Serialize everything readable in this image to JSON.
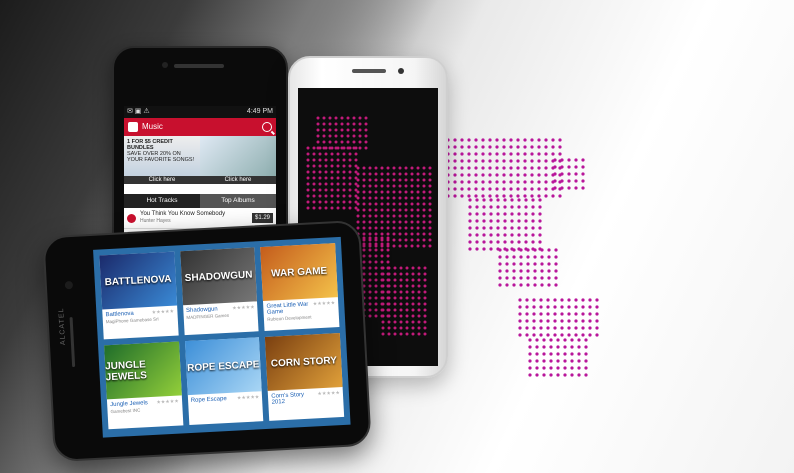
{
  "phone_music": {
    "status_time": "4:49 PM",
    "app_title": "Music",
    "promo_left": "1 FOR $5 CREDIT BUNDLES",
    "promo_left_sub": "SAVE OVER 20% ON YOUR FAVORITE SONGS!",
    "promo_click_left": "Click here",
    "promo_click_right": "Click here",
    "tab_hot": "Hot Tracks",
    "tab_albums": "Top Albums",
    "track_title": "You Think You Know Somebody",
    "track_artist": "Hunter Hayes",
    "track_price": "$1.29"
  },
  "phone_games": {
    "brand": "ALCATEL",
    "games": [
      {
        "art": "BATTLENOVA",
        "name": "Battlenova",
        "publisher": "MagiPhone Gamebase Srl"
      },
      {
        "art": "SHADOWGUN",
        "name": "Shadowgun",
        "publisher": "MADFINGER Games"
      },
      {
        "art": "WAR GAME",
        "name": "Great Little War Game",
        "publisher": "Rubicon Development"
      },
      {
        "art": "JUNGLE JEWELS",
        "name": "Jungle Jewels",
        "publisher": "Gamebest INC"
      },
      {
        "art": "ROPE ESCAPE",
        "name": "Rope Escape",
        "publisher": ""
      },
      {
        "art": "CORN STORY",
        "name": "Corn's Story 2012",
        "publisher": ""
      }
    ]
  },
  "colors": {
    "accent": "#c8102e",
    "dot": "#b8169a",
    "games_bg": "#2b6ea8"
  }
}
